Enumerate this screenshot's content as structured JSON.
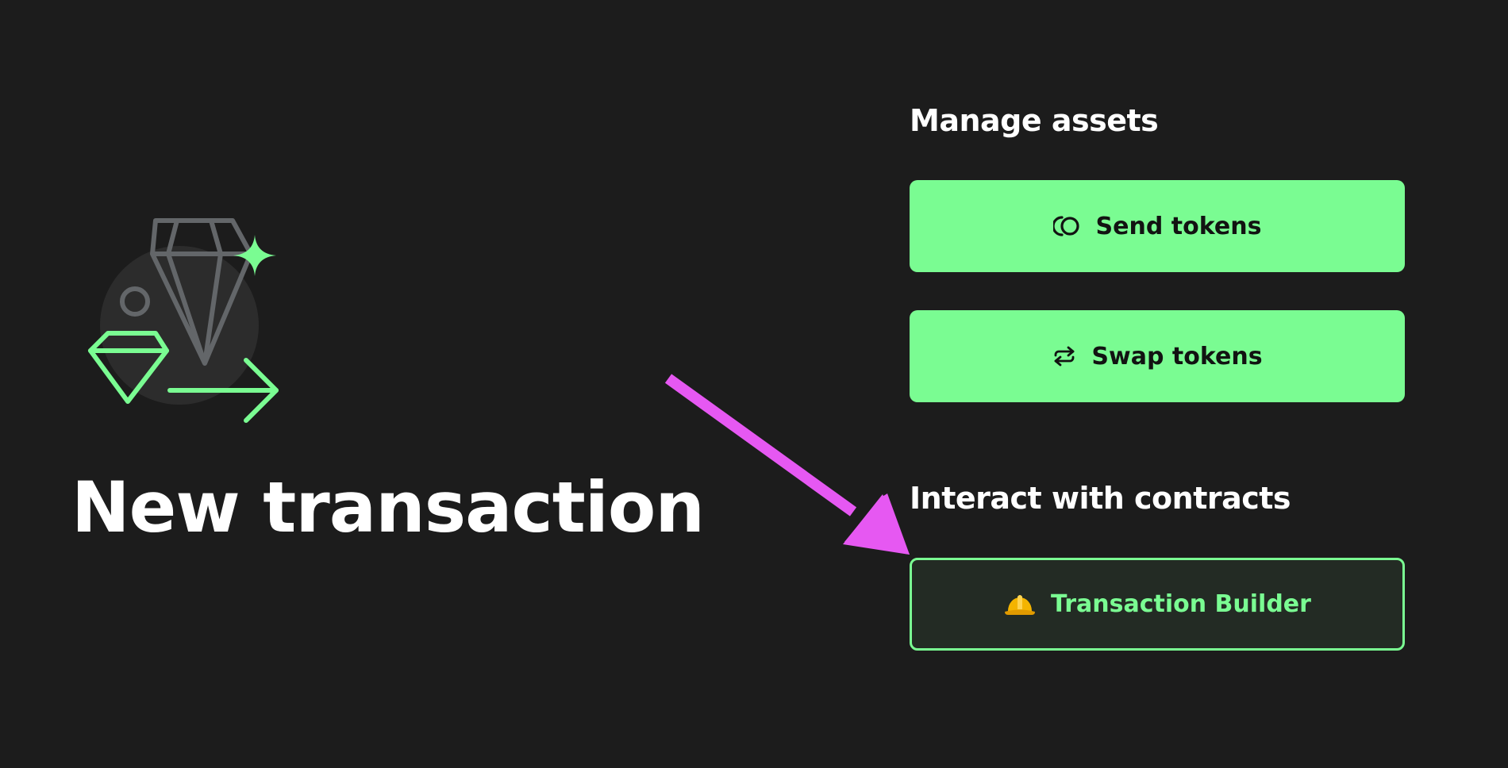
{
  "page": {
    "title": "New transaction"
  },
  "manage_assets": {
    "heading": "Manage assets",
    "send_label": "Send tokens",
    "swap_label": "Swap tokens"
  },
  "contracts": {
    "heading": "Interact with contracts",
    "builder_label": "Transaction Builder",
    "builder_icon": "hard-hat-icon"
  },
  "icons": {
    "send": "send-tokens-icon",
    "swap": "swap-arrows-icon",
    "hero": "diamond-transfer-illustration"
  },
  "colors": {
    "background": "#1c1c1c",
    "accent": "#7afc92",
    "annotation_arrow": "#e658f2",
    "builder_bg": "#232b24",
    "illustration_gray": "#636669"
  }
}
